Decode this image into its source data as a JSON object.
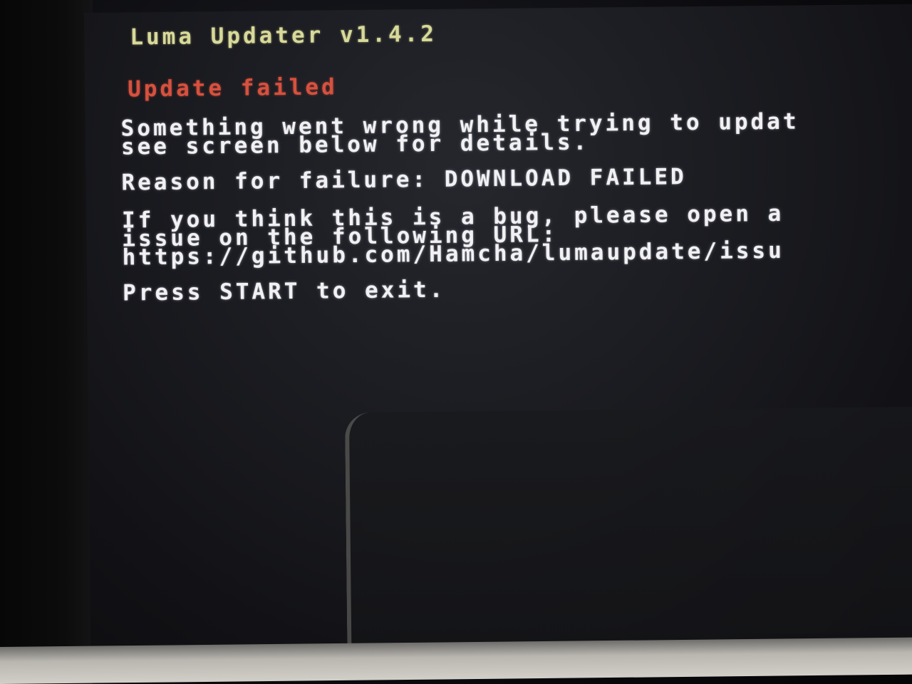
{
  "app": {
    "title": "Luma Updater v1.4.2"
  },
  "status": {
    "heading": "Update failed",
    "message_lines": [
      "Something went wrong while trying to updat",
      "see screen below for details."
    ],
    "reason": "Reason for failure: DOWNLOAD FAILED"
  },
  "bug_report": {
    "lines": [
      "If you think this is a bug, please open a",
      "issue on the following URL:",
      "https://github.com/Hamcha/lumaupdate/issu"
    ]
  },
  "prompt": {
    "exit_text": "Press START to exit."
  },
  "colors": {
    "title": "#d8d99a",
    "error": "#d6513f",
    "text": "#f1f1f4",
    "background": "#1b1c21"
  }
}
